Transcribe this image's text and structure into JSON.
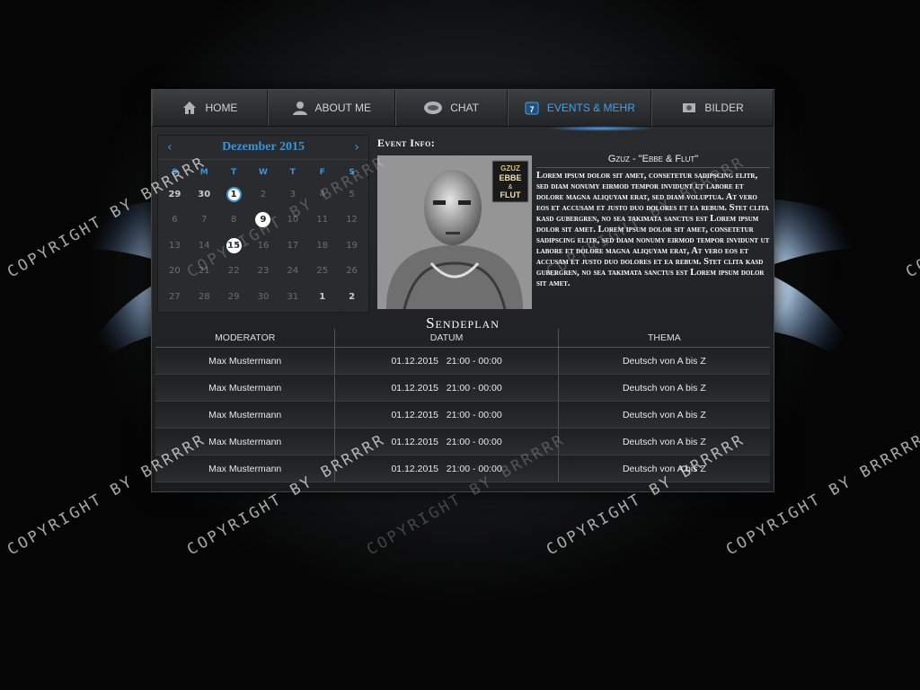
{
  "nav": {
    "items": [
      {
        "label": "HOME",
        "icon": "home-icon"
      },
      {
        "label": "ABOUT ME",
        "icon": "user-icon"
      },
      {
        "label": "CHAT",
        "icon": "chat-icon"
      },
      {
        "label": "EVENTS & MEHR",
        "icon": "calendar-icon",
        "active": true
      },
      {
        "label": "BILDER",
        "icon": "image-icon"
      }
    ]
  },
  "calendar": {
    "prev": "‹",
    "next": "›",
    "title": "Dezember 2015",
    "weekdays": [
      "S",
      "M",
      "T",
      "W",
      "T",
      "F",
      "S"
    ],
    "weeks": [
      [
        "29",
        "30",
        "1",
        "2",
        "3",
        "4",
        "5"
      ],
      [
        "6",
        "7",
        "8",
        "9",
        "10",
        "11",
        "12"
      ],
      [
        "13",
        "14",
        "15",
        "16",
        "17",
        "18",
        "19"
      ],
      [
        "20",
        "21",
        "22",
        "23",
        "24",
        "25",
        "26"
      ],
      [
        "27",
        "28",
        "29",
        "30",
        "31",
        "1",
        "2"
      ]
    ]
  },
  "event": {
    "heading": "Event Info:",
    "song": "Gzuz - \"Ebbe & Flut\"",
    "album_cover_text": [
      "GZUZ",
      "EBBE",
      "&",
      "FLUT"
    ],
    "body": "Lorem ipsum dolor sit amet, consetetur sadipscing elitr, sed diam nonumy eirmod tempor invidunt ut labore et dolore magna aliquyam erat, sed diam voluptua. At vero eos et accusam et justo duo dolores et ea rebum. Stet clita kasd gubergren, no sea takimata sanctus est Lorem ipsum dolor sit amet. Lorem ipsum dolor sit amet, consetetur sadipscing elitr, sed diam nonumy eirmod tempor invidunt ut labore et dolore magna aliquyam erat, At vero eos et accusam et justo duo dolores et ea rebum. Stet clita kasd gubergren, no sea takimata sanctus est Lorem ipsum dolor sit amet."
  },
  "schedule": {
    "title": "Sendeplan",
    "headers": [
      "MODERATOR",
      "DATUM",
      "THEMA"
    ],
    "rows": [
      [
        "Max Mustermann",
        "01.12.2015   21:00 - 00:00",
        "Deutsch von A bis Z"
      ],
      [
        "Max Mustermann",
        "01.12.2015   21:00 - 00:00",
        "Deutsch von A bis Z"
      ],
      [
        "Max Mustermann",
        "01.12.2015   21:00 - 00:00",
        "Deutsch von A bis Z"
      ],
      [
        "Max Mustermann",
        "01.12.2015   21:00 - 00:00",
        "Deutsch von A bis Z"
      ],
      [
        "Max Mustermann",
        "01.12.2015   21:00 - 00:00",
        "Deutsch von A bis Z"
      ]
    ]
  },
  "watermark": "COPYRIGHT BY BRRRRR",
  "colors": {
    "accent": "#3a95d8",
    "background": "#000000"
  }
}
